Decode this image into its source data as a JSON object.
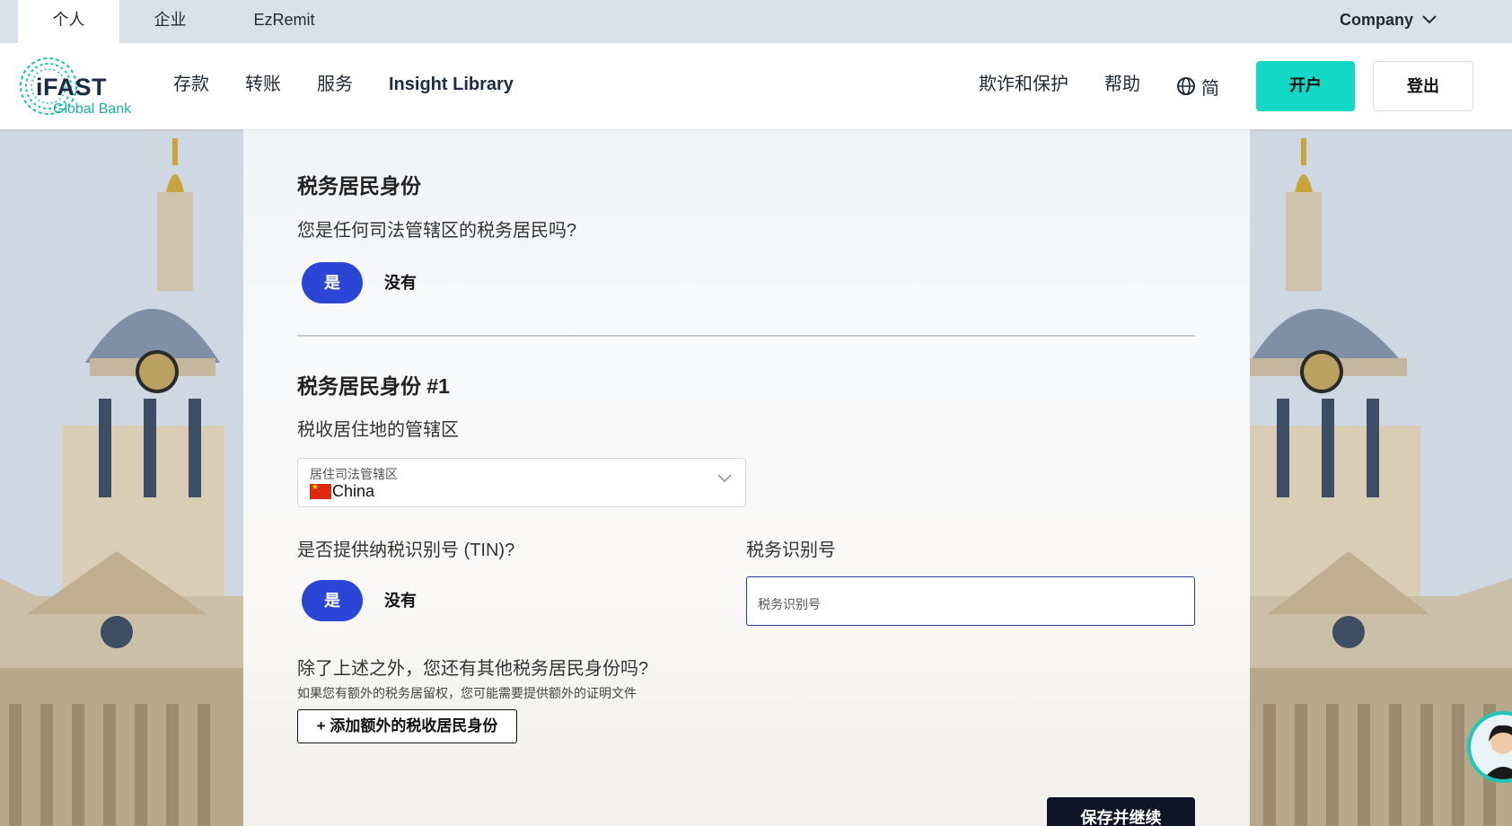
{
  "top_tabs": [
    {
      "label": "个人",
      "active": true
    },
    {
      "label": "企业",
      "active": false
    },
    {
      "label": "EzRemit",
      "active": false
    }
  ],
  "company_menu": {
    "label": "Company",
    "icon": "chevron-down-icon"
  },
  "logo": {
    "line1": "iFAST",
    "line2": "Global Bank"
  },
  "nav": {
    "links": [
      "存款",
      "转账",
      "服务",
      "Insight Library"
    ],
    "fraud": "欺诈和保护",
    "help": "帮助",
    "language": {
      "icon": "globe-icon",
      "label": "简"
    },
    "open_account": "开户",
    "logout": "登出"
  },
  "colors": {
    "accent_teal": "#11d9c5",
    "pill_blue": "#2b46d6",
    "dark_button": "#0d1526",
    "input_border": "#2a3a8c"
  },
  "form": {
    "section_title": "税务居民身份",
    "question": "您是任何司法管辖区的税务居民吗?",
    "resident_yes": "是",
    "resident_no": "没有",
    "residency1": {
      "title": "税务居民身份 #1",
      "jurisdiction_label": "税收居住地的管辖区",
      "select_label": "居住司法管辖区",
      "select_value": "China",
      "tin_question": "是否提供纳税识别号 (TIN)?",
      "tin_yes": "是",
      "tin_no": "没有",
      "tin_label": "税务识别号",
      "tin_placeholder": "税务识别号"
    },
    "other_question": "除了上述之外，您还有其他税务居民身份吗?",
    "other_hint": "如果您有额外的税务居留权，您可能需要提供额外的证明文件",
    "add_button": "+ 添加额外的税收居民身份",
    "save_button": "保存并继续"
  }
}
